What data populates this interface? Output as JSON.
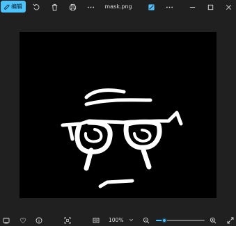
{
  "toolbar": {
    "edit_label": "编辑",
    "title": "mask.png"
  },
  "status": {
    "zoom_label": "100%",
    "zoom_fraction": 0.17
  },
  "colors": {
    "accent": "#4cc2ff",
    "background": "#202020",
    "image_bg": "#000000"
  },
  "icons": {
    "top": [
      "edit-icon",
      "rotate-icon",
      "delete-icon",
      "print-icon",
      "more-icon",
      "enhance-icon",
      "more-icon",
      "minimize-icon",
      "maximize-icon",
      "close-icon"
    ],
    "bottom": [
      "filmstrip-icon",
      "favorite-icon",
      "info-icon",
      "fit-icon",
      "actual-size-icon",
      "zoom-out-icon",
      "zoom-in-icon",
      "fullscreen-icon"
    ]
  }
}
